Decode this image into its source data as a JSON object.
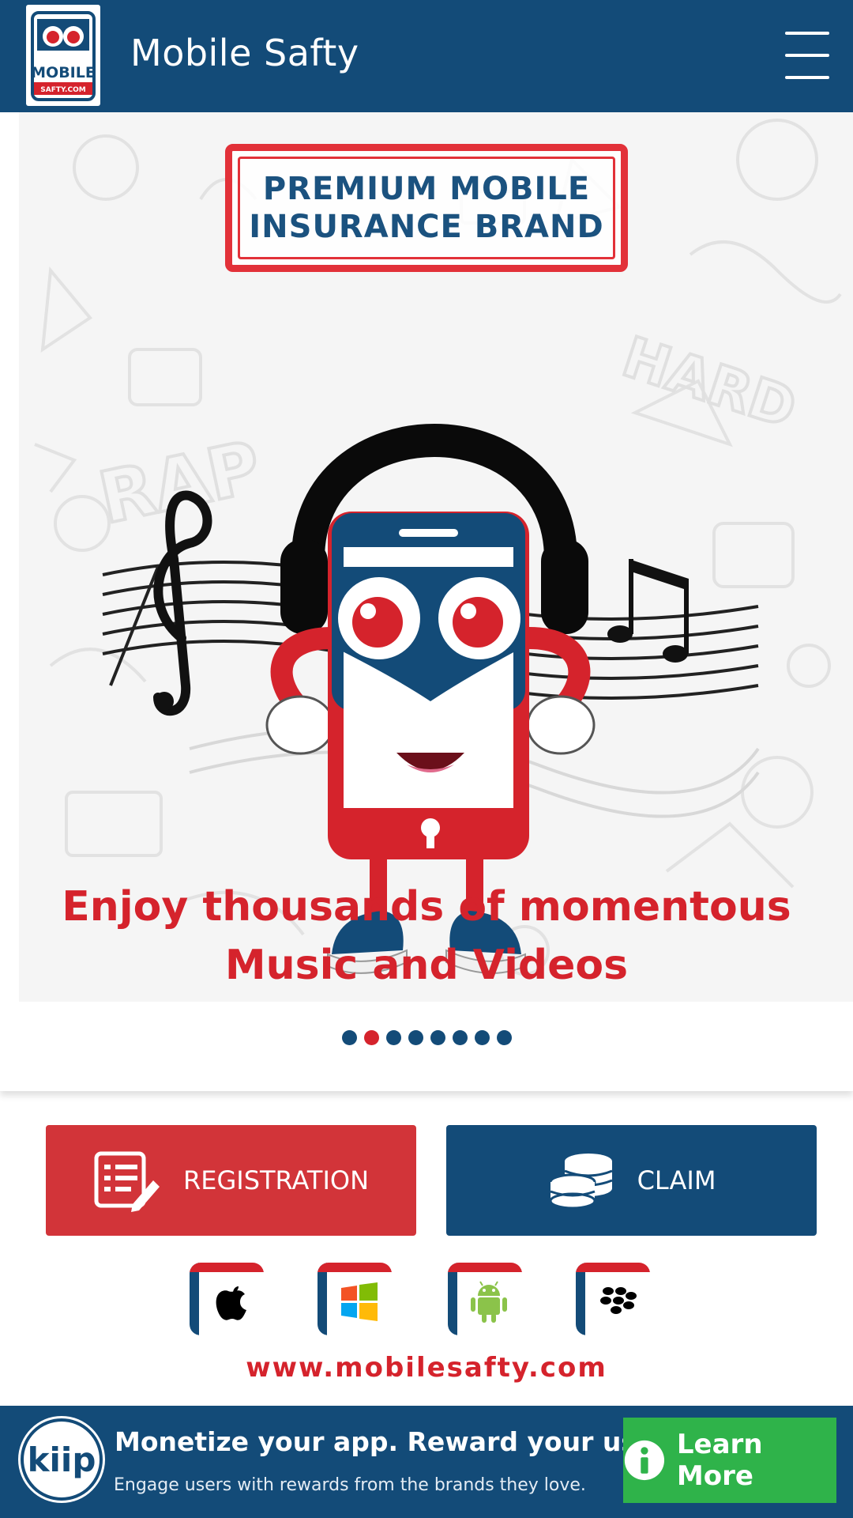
{
  "header": {
    "title": "Mobile Safty",
    "logo_text_line1": "MOBILE",
    "logo_text_line2": "SAFTY.COM",
    "menu_icon": "hamburger-menu-icon"
  },
  "hero": {
    "badge_line1": "PREMIUM MOBILE",
    "badge_line2": "INSURANCE BRAND",
    "headline_line1": "Enjoy thousands of momentous",
    "headline_line2": "Music and Videos",
    "slide_count": 8,
    "active_slide": 2
  },
  "actions": {
    "registration_label": "REGISTRATION",
    "registration_icon": "form-edit-icon",
    "claim_label": "CLAIM",
    "claim_icon": "coin-stack-icon"
  },
  "platforms": [
    {
      "name": "apple-icon"
    },
    {
      "name": "windows-icon"
    },
    {
      "name": "android-icon"
    },
    {
      "name": "blackberry-icon"
    }
  ],
  "website": "www.mobilesafty.com",
  "ad": {
    "logo": "kiip",
    "title": "Monetize your app. Reward your users.",
    "subtitle": "Engage users with rewards from the brands they love.",
    "cta": "Learn More",
    "cta_icon": "info-icon"
  },
  "colors": {
    "primary_blue": "#134b78",
    "accent_red": "#d5232c",
    "cta_green": "#2fb34a"
  }
}
